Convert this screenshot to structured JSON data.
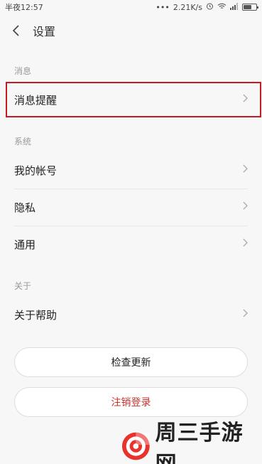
{
  "status": {
    "time": "半夜12:57",
    "dots": "•••",
    "speed": "2.21K/s"
  },
  "header": {
    "title": "设置"
  },
  "sections": {
    "messages": "消息",
    "system": "系统",
    "about": "关于"
  },
  "rows": {
    "notify": "消息提醒",
    "account": "我的帐号",
    "privacy": "隐私",
    "general": "通用",
    "help": "关于帮助"
  },
  "buttons": {
    "check_update": "检查更新",
    "logout": "注销登录"
  },
  "watermark": {
    "text": "周三手游网"
  },
  "colors": {
    "highlight": "#c21b22",
    "logout": "#c9322c"
  }
}
